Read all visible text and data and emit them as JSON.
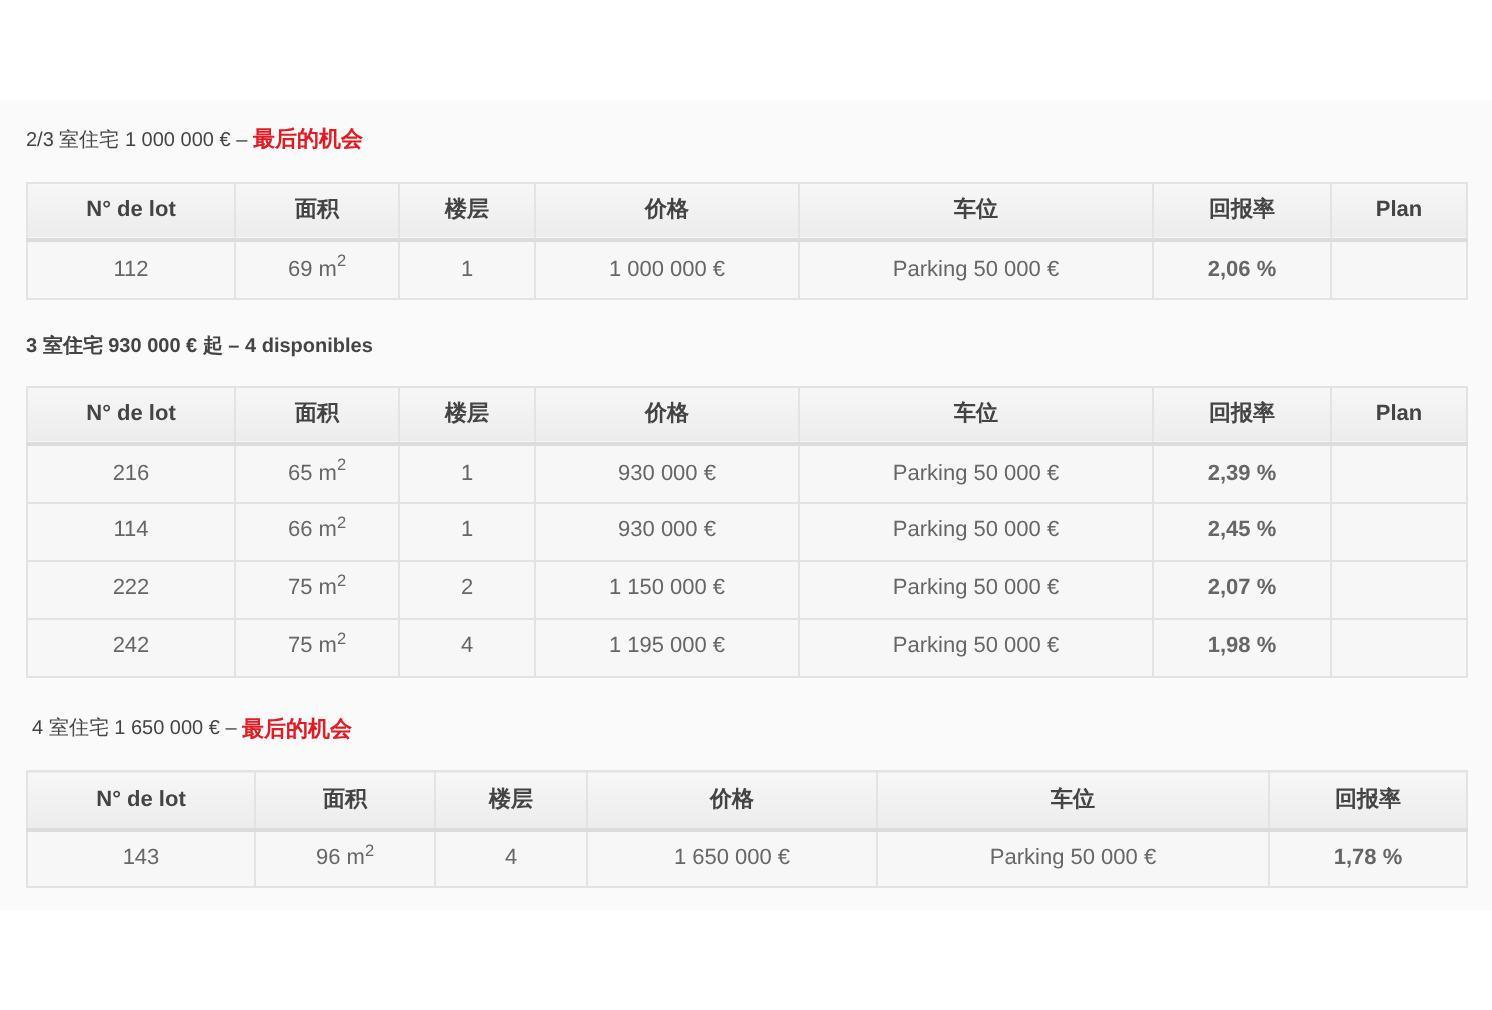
{
  "sections": [
    {
      "heading": {
        "text": "2/3 室住宅 1 000 000 € – ",
        "highlight": "最后的机会"
      },
      "table": {
        "columns": [
          "N° de lot",
          "面积",
          "楼层",
          "价格",
          "车位",
          "回报率",
          "Plan"
        ],
        "rows": [
          [
            "112",
            "69 m$^{2}$",
            "1",
            "1 000 000 €",
            "Parking 50 000 €",
            "2,06 %"
          ]
        ]
      }
    },
    {
      "heading": {
        "text": "3 室住宅 930 000 € 起 – 4 disponibles"
      },
      "table": {
        "columns": [
          "N° de lot",
          "面积",
          "楼层",
          "价格",
          "车位",
          "回报率",
          "Plan"
        ],
        "rows": [
          [
            "216",
            "65 m$^{2}$",
            "1",
            "930 000 €",
            "Parking 50 000 €",
            "2,39 %"
          ],
          [
            "114",
            "66 m$^{2}$",
            "1",
            "930 000 €",
            "Parking 50 000 €",
            "2,45 %"
          ],
          [
            "222",
            "75 m$^{2}$",
            "2",
            "1 150 000 €",
            "Parking 50 000 €",
            "2,07 %"
          ],
          [
            "242",
            "75 m$^{2}$",
            "4",
            "1 195 000 €",
            "Parking 50 000 €",
            "1,98 %"
          ]
        ]
      }
    },
    {
      "heading": {
        "text": "4 室住宅 1 650 000 € – ",
        "highlight": "最后的机会"
      },
      "table": {
        "columns": [
          "N° de lot",
          "面积",
          "楼层",
          "价格",
          "车位",
          "回报率"
        ],
        "rows": [
          [
            "143",
            "96 m$^{2}$",
            "4",
            "1 650 000 €",
            "Parking 50 000 €",
            "1,78 %"
          ]
        ]
      }
    }
  ]
}
